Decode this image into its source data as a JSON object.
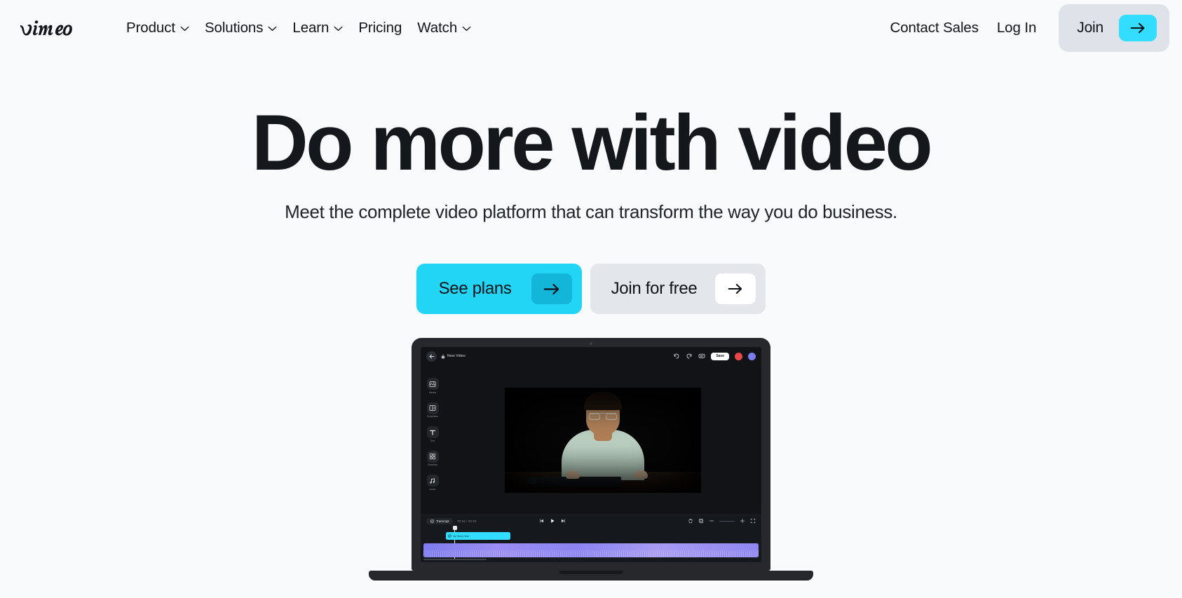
{
  "brand": {
    "logo_text": "vimeo",
    "accent_cyan": "#23d5f5",
    "accent_cyan_dark": "#13b6d8",
    "gray_pill": "#dfe3e9",
    "ink": "#14171c",
    "page_bg": "#f9fafb"
  },
  "header": {
    "nav_items": [
      {
        "label": "Product",
        "has_chevron": true,
        "chevron_icon": "chevron-down-icon"
      },
      {
        "label": "Solutions",
        "has_chevron": true,
        "chevron_icon": "chevron-down-icon"
      },
      {
        "label": "Learn",
        "has_chevron": true,
        "chevron_icon": "chevron-down-icon"
      },
      {
        "label": "Pricing",
        "has_chevron": false
      },
      {
        "label": "Watch",
        "has_chevron": true,
        "chevron_icon": "chevron-down-icon"
      }
    ],
    "contact_sales": "Contact Sales",
    "log_in": "Log In",
    "join": "Join",
    "join_arrow_icon": "arrow-right-icon"
  },
  "hero": {
    "heading": "Do more with video",
    "subheading": "Meet the complete video platform that can transform the way you do business.",
    "cta_primary": {
      "label": "See plans",
      "arrow_icon": "arrow-right-icon"
    },
    "cta_secondary": {
      "label": "Join for free",
      "arrow_icon": "arrow-right-icon"
    }
  },
  "editor_mockup": {
    "topbar": {
      "back_icon": "arrow-left-icon",
      "lock_icon": "lock-icon",
      "project_title": "New Video",
      "undo_icon": "undo-icon",
      "redo_icon": "redo-icon",
      "comment_icon": "comment-icon",
      "save_label": "Save",
      "avatar_1": "avatar-red",
      "avatar_2": "avatar-blue"
    },
    "sidebar": [
      {
        "label": "Media",
        "icon": "media-icon"
      },
      {
        "label": "Templates",
        "icon": "templates-icon"
      },
      {
        "label": "Text",
        "icon": "text-icon"
      },
      {
        "label": "Graphics",
        "icon": "graphics-icon"
      },
      {
        "label": "Audio",
        "icon": "audio-icon"
      }
    ],
    "timeline": {
      "transcript_label": "Transcript",
      "transcript_icon": "transcript-icon",
      "time_display": "00:06 / 00:50",
      "prev_icon": "skip-back-icon",
      "play_icon": "play-icon",
      "next_icon": "skip-forward-icon",
      "delete_icon": "trash-icon",
      "duplicate_icon": "duplicate-icon",
      "zoom_out_icon": "zoom-out-icon",
      "zoom_in_icon": "zoom-in-icon",
      "fit_icon": "fit-icon",
      "clip_label": "My Story Here",
      "clip_caption_icon": "caption-icon"
    }
  }
}
